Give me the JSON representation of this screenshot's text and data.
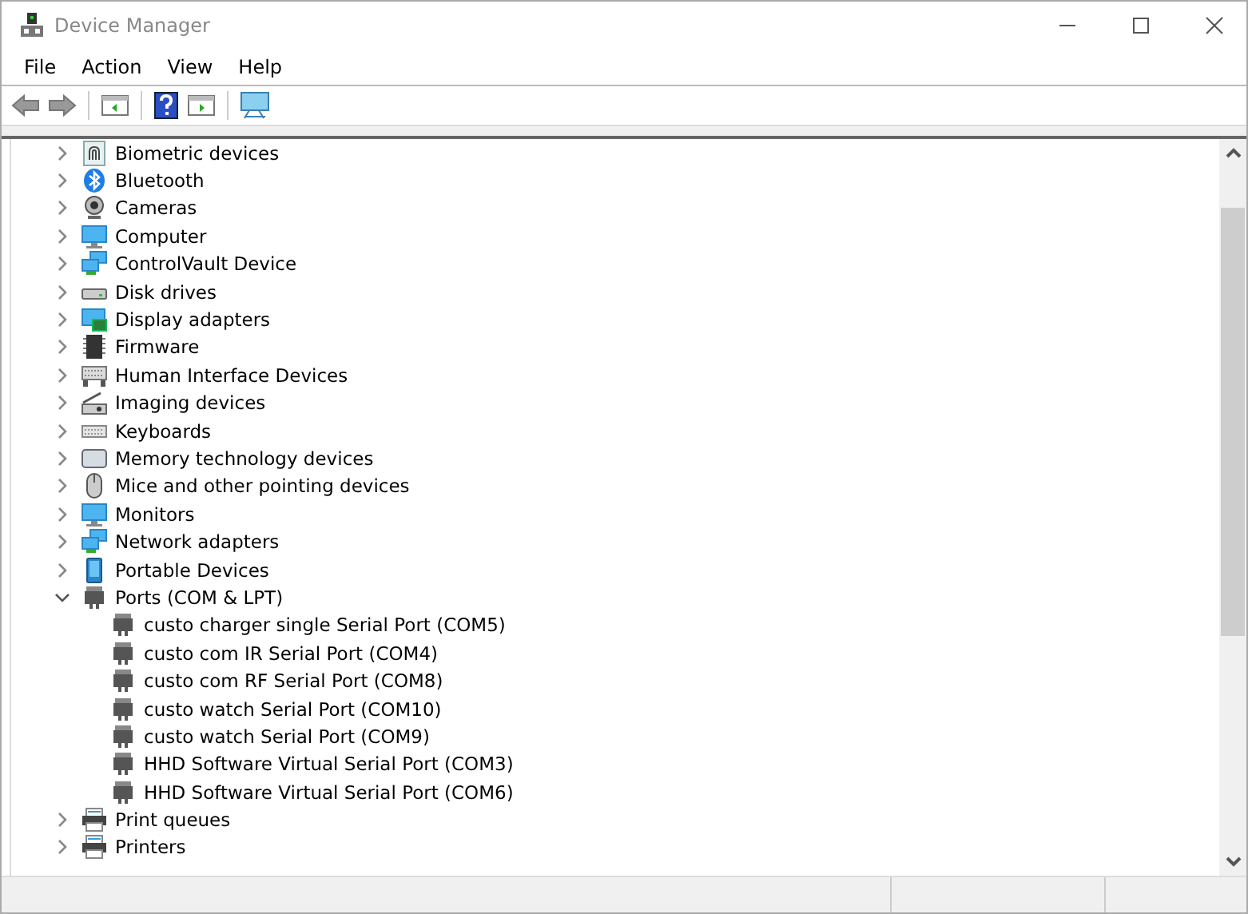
{
  "window": {
    "title": "Device Manager"
  },
  "menu": [
    "File",
    "Action",
    "View",
    "Help"
  ],
  "tree": [
    {
      "label": "Biometric devices",
      "expanded": false
    },
    {
      "label": "Bluetooth",
      "expanded": false
    },
    {
      "label": "Cameras",
      "expanded": false
    },
    {
      "label": "Computer",
      "expanded": false
    },
    {
      "label": "ControlVault Device",
      "expanded": false
    },
    {
      "label": "Disk drives",
      "expanded": false
    },
    {
      "label": "Display adapters",
      "expanded": false
    },
    {
      "label": "Firmware",
      "expanded": false
    },
    {
      "label": "Human Interface Devices",
      "expanded": false
    },
    {
      "label": "Imaging devices",
      "expanded": false
    },
    {
      "label": "Keyboards",
      "expanded": false
    },
    {
      "label": "Memory technology devices",
      "expanded": false
    },
    {
      "label": "Mice and other pointing devices",
      "expanded": false
    },
    {
      "label": "Monitors",
      "expanded": false
    },
    {
      "label": "Network adapters",
      "expanded": false
    },
    {
      "label": "Portable Devices",
      "expanded": false
    },
    {
      "label": "Ports (COM & LPT)",
      "expanded": true,
      "children": [
        {
          "label": "custo charger single Serial Port (COM5)"
        },
        {
          "label": "custo com IR Serial Port (COM4)"
        },
        {
          "label": "custo com RF Serial Port (COM8)"
        },
        {
          "label": "custo watch Serial Port (COM10)"
        },
        {
          "label": "custo watch Serial Port (COM9)"
        },
        {
          "label": "HHD Software Virtual Serial Port (COM3)"
        },
        {
          "label": "HHD Software Virtual Serial Port (COM6)"
        }
      ]
    },
    {
      "label": "Print queues",
      "expanded": false
    },
    {
      "label": "Printers",
      "expanded": false
    }
  ]
}
